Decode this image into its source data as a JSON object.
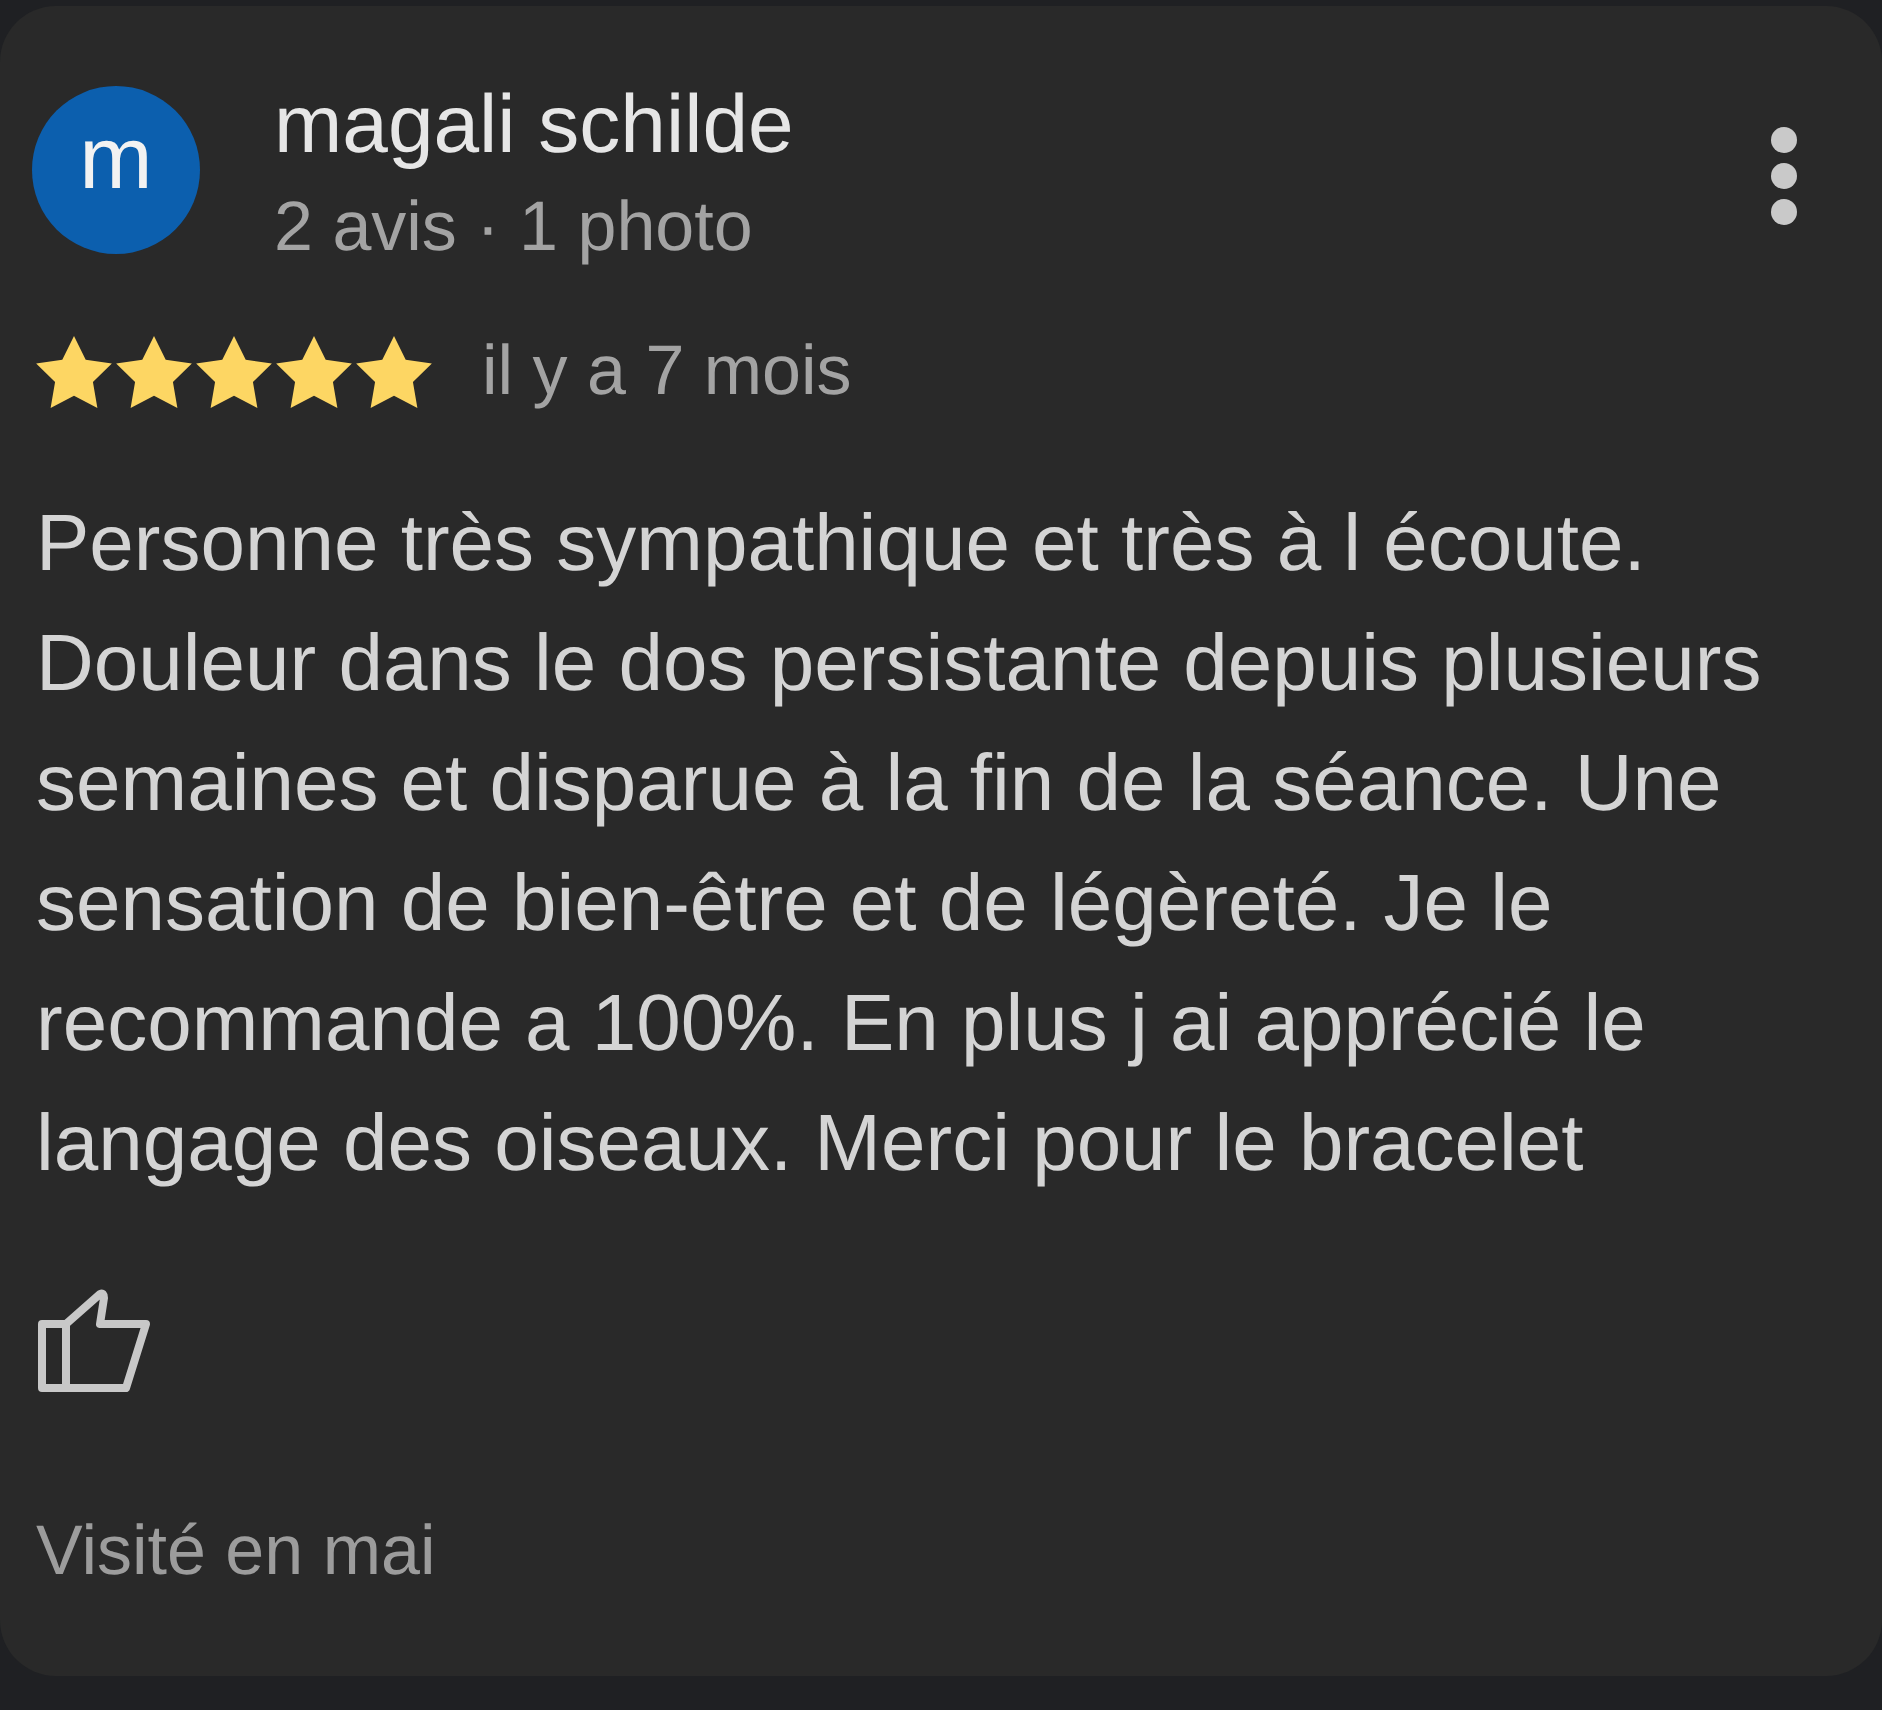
{
  "review": {
    "author": {
      "initial": "m",
      "name": "magali schilde",
      "meta": "2 avis · 1 photo"
    },
    "stars": 5,
    "time": "il y a 7 mois",
    "text": "Personne très sympathique et très à l écoute. Douleur dans le dos persistante depuis plusieurs semaines et disparue à la fin de la séance. Une sensation de bien-être et de légèreté. Je le recommande a 100%. En plus j ai apprécié le langage des oiseaux. Merci pour le bracelet",
    "visited": "Visité en mai"
  }
}
